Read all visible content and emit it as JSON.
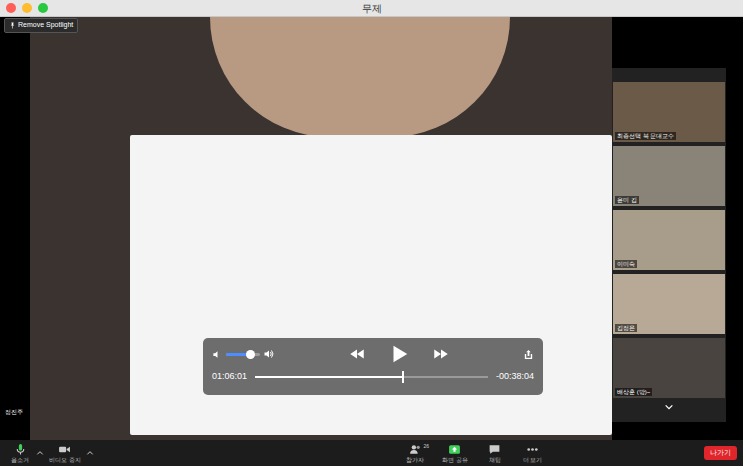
{
  "window": {
    "title": "무제"
  },
  "spotlight_button": "Remove Spotlight",
  "main_video": {
    "name": "정진주"
  },
  "player": {
    "volume_level": 0.7,
    "playing": false,
    "elapsed": "01:06:01",
    "remaining": "-00:38:04",
    "progress_level": 0.63
  },
  "participants": [
    {
      "name": "최종선택 북 문대교수"
    },
    {
      "name": "윤미 김"
    },
    {
      "name": "이미숙"
    },
    {
      "name": "김정은"
    },
    {
      "name": "배상훈 (방)~"
    }
  ],
  "toolbar": {
    "left": [
      {
        "label": "음소거",
        "kind": "mic"
      },
      {
        "label": "비디오 중지",
        "kind": "video"
      }
    ],
    "center": [
      {
        "label": "참가자",
        "kind": "participants",
        "badge": "26"
      },
      {
        "label": "화면 공유",
        "kind": "share"
      },
      {
        "label": "채팅",
        "kind": "chat"
      },
      {
        "label": "더 보기",
        "kind": "more"
      }
    ],
    "leave": "나가기"
  }
}
